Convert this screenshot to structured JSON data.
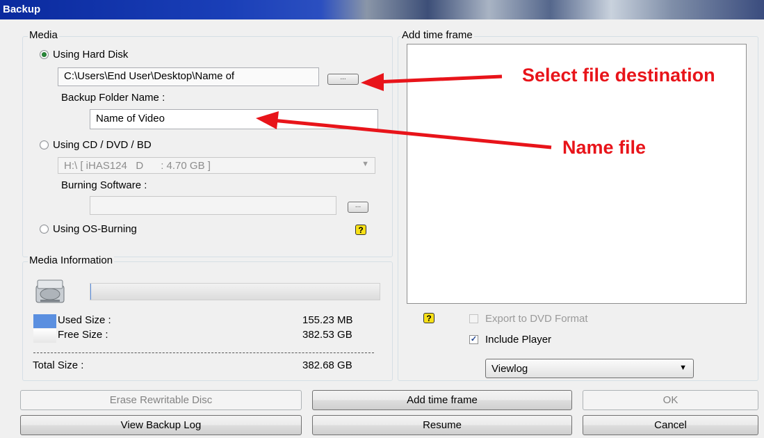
{
  "window": {
    "title": "Backup"
  },
  "media": {
    "label": "Media",
    "hard_disk_label": "Using Hard Disk",
    "path_value": "C:\\Users\\End User\\Desktop\\Name of",
    "browse_label": "...",
    "folder_name_label": "Backup Folder Name :",
    "folder_name_value": "Name of Video",
    "cd_label": "Using CD / DVD / BD",
    "drive_value": "H:\\ [ iHAS124   D      : 4.70 GB ]",
    "burning_software_label": "Burning Software :",
    "burning_browse_label": "...",
    "os_burning_label": "Using OS-Burning",
    "help_label": "?"
  },
  "media_info": {
    "label": "Media Information",
    "used_label": "Used Size :",
    "used_value": "155.23 MB",
    "free_label": "Free Size :",
    "free_value": "382.53 GB",
    "total_label": "Total Size :",
    "total_value": "382.68 GB",
    "used_fraction": 0.0004,
    "used_color": "#5a8fe0"
  },
  "time_frame": {
    "label": "Add time frame",
    "help_label": "?",
    "export_dvd_label": "Export to DVD Format",
    "include_player_label": "Include Player",
    "include_player_checked": "✓",
    "player_select_value": "Viewlog"
  },
  "buttons": {
    "erase": "Erase Rewritable Disc",
    "add_time_frame": "Add time frame",
    "ok": "OK",
    "view_log": "View Backup Log",
    "resume": "Resume",
    "cancel": "Cancel"
  },
  "annotations": {
    "select_destination": "Select file destination",
    "name_file": "Name file",
    "arrow_color": "#e8141a"
  }
}
